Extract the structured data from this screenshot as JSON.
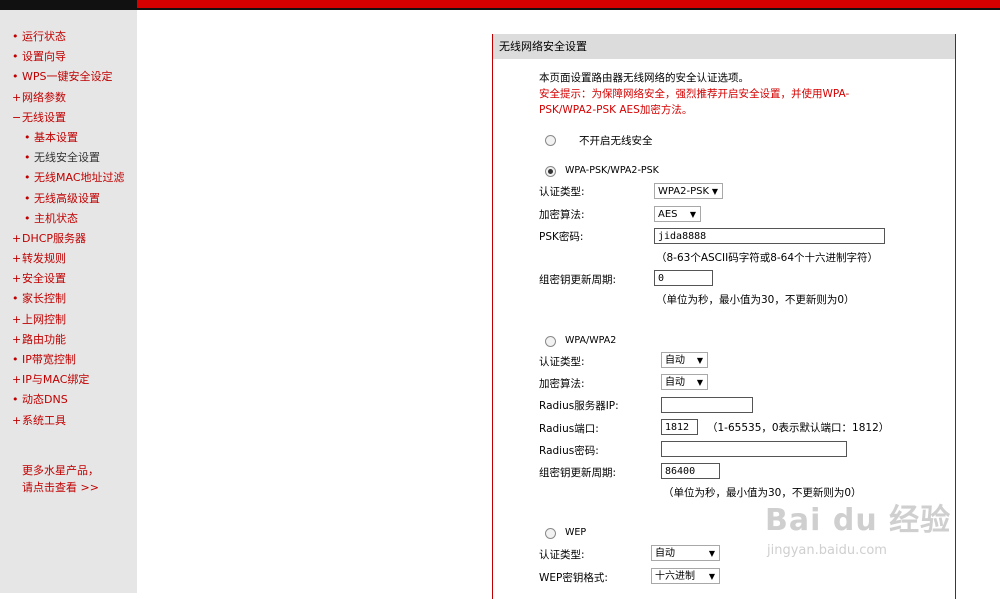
{
  "sidebar": {
    "items": [
      {
        "marker": "•",
        "label": "运行状态"
      },
      {
        "marker": "•",
        "label": "设置向导"
      },
      {
        "marker": "•",
        "label": "WPS一键安全设定"
      },
      {
        "marker": "+",
        "label": "网络参数"
      },
      {
        "marker": "−",
        "label": "无线设置"
      },
      {
        "marker": "•",
        "label": "基本设置"
      },
      {
        "marker": "•",
        "label": "无线安全设置"
      },
      {
        "marker": "•",
        "label": "无线MAC地址过滤"
      },
      {
        "marker": "•",
        "label": "无线高级设置"
      },
      {
        "marker": "•",
        "label": "主机状态"
      },
      {
        "marker": "+",
        "label": "DHCP服务器"
      },
      {
        "marker": "+",
        "label": "转发规则"
      },
      {
        "marker": "+",
        "label": "安全设置"
      },
      {
        "marker": "•",
        "label": "家长控制"
      },
      {
        "marker": "+",
        "label": "上网控制"
      },
      {
        "marker": "+",
        "label": "路由功能"
      },
      {
        "marker": "•",
        "label": "IP带宽控制"
      },
      {
        "marker": "+",
        "label": "IP与MAC绑定"
      },
      {
        "marker": "•",
        "label": "动态DNS"
      },
      {
        "marker": "+",
        "label": "系统工具"
      }
    ],
    "more_line1": "更多水星产品，",
    "more_line2": "请点击查看 >>"
  },
  "panel": {
    "title": "无线网络安全设置",
    "intro": "本页面设置路由器无线网络的安全认证选项。",
    "warning_line1": "安全提示：为保障网络安全，强烈推荐开启安全设置，并使用WPA-",
    "warning_line2": "PSK/WPA2-PSK AES加密方法。",
    "disable_label": "不开启无线安全",
    "psk": {
      "label": "WPA-PSK/WPA2-PSK",
      "auth_label": "认证类型:",
      "auth_value": "WPA2-PSK",
      "enc_label": "加密算法:",
      "enc_value": "AES",
      "key_label": "PSK密码:",
      "key_value": "jida8888",
      "key_hint": "（8-63个ASCII码字符或8-64个十六进制字符）",
      "renew_label": "组密钥更新周期:",
      "renew_value": "0",
      "renew_hint": "（单位为秒，最小值为30，不更新则为0）"
    },
    "wpa": {
      "label": "WPA/WPA2",
      "auth_label": "认证类型:",
      "auth_value": "自动",
      "enc_label": "加密算法:",
      "enc_value": "自动",
      "server_label": "Radius服务器IP:",
      "server_value": "",
      "port_label": "Radius端口:",
      "port_value": "1812",
      "port_hint": "（1-65535，0表示默认端口：1812）",
      "pwd_label": "Radius密码:",
      "pwd_value": "",
      "renew_label": "组密钥更新周期:",
      "renew_value": "86400",
      "renew_hint": "（单位为秒，最小值为30，不更新则为0）"
    },
    "wep": {
      "label": "WEP",
      "auth_label": "认证类型:",
      "auth_value": "自动",
      "format_label": "WEP密钥格式:",
      "format_value": "十六进制"
    }
  },
  "watermark": {
    "brand": "Bai du 经验",
    "url": "jingyan.baidu.com"
  },
  "colors": {
    "accent_red": "#d40000",
    "sidebar_bg": "#e6e6e6",
    "header_bg": "#dcdcdc"
  }
}
